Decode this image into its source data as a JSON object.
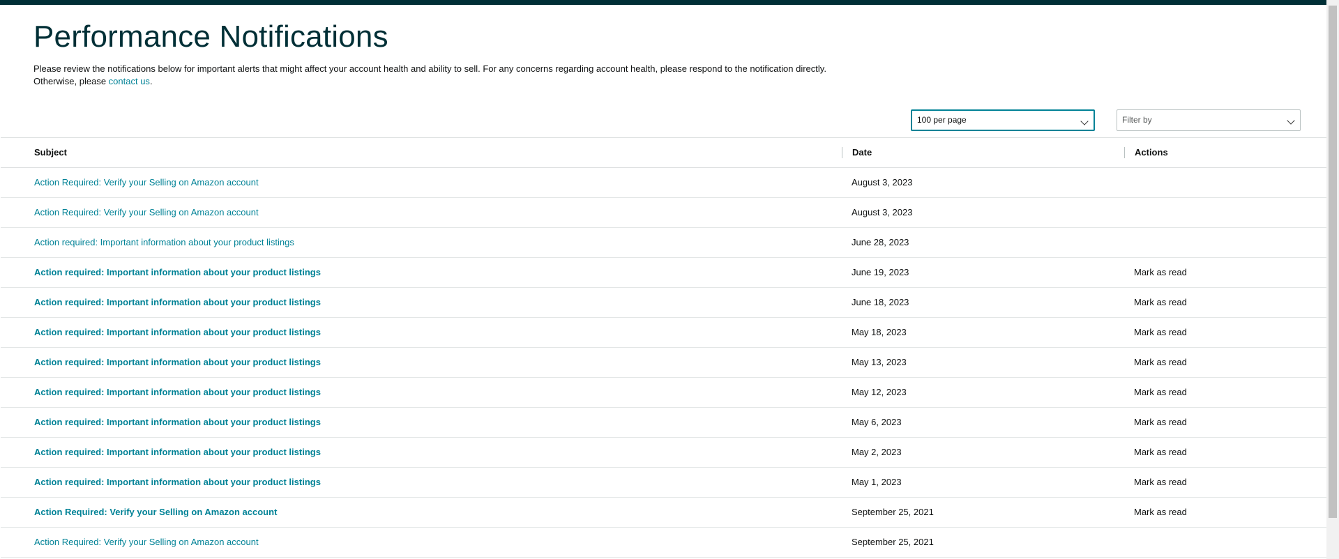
{
  "header": {
    "title": "Performance Notifications",
    "intro_line1": "Please review the notifications below for important alerts that might affect your account health and ability to sell. For any concerns regarding account health, please respond to the notification directly.",
    "intro_line2_prefix": "Otherwise, please ",
    "contact_link": "contact us",
    "intro_line2_suffix": "."
  },
  "controls": {
    "per_page": "100 per page",
    "filter_placeholder": "Filter by"
  },
  "table": {
    "columns": {
      "subject": "Subject",
      "date": "Date",
      "actions": "Actions"
    },
    "rows": [
      {
        "subject": "Action Required: Verify your Selling on Amazon account",
        "date": "August 3, 2023",
        "action": "",
        "unread": false
      },
      {
        "subject": "Action Required: Verify your Selling on Amazon account",
        "date": "August 3, 2023",
        "action": "",
        "unread": false
      },
      {
        "subject": "Action required: Important information about your product listings",
        "date": "June 28, 2023",
        "action": "",
        "unread": false
      },
      {
        "subject": "Action required: Important information about your product listings",
        "date": "June 19, 2023",
        "action": "Mark as read",
        "unread": true
      },
      {
        "subject": "Action required: Important information about your product listings",
        "date": "June 18, 2023",
        "action": "Mark as read",
        "unread": true
      },
      {
        "subject": "Action required: Important information about your product listings",
        "date": "May 18, 2023",
        "action": "Mark as read",
        "unread": true
      },
      {
        "subject": "Action required: Important information about your product listings",
        "date": "May 13, 2023",
        "action": "Mark as read",
        "unread": true
      },
      {
        "subject": "Action required: Important information about your product listings",
        "date": "May 12, 2023",
        "action": "Mark as read",
        "unread": true
      },
      {
        "subject": "Action required: Important information about your product listings",
        "date": "May 6, 2023",
        "action": "Mark as read",
        "unread": true
      },
      {
        "subject": "Action required: Important information about your product listings",
        "date": "May 2, 2023",
        "action": "Mark as read",
        "unread": true
      },
      {
        "subject": "Action required: Important information about your product listings",
        "date": "May 1, 2023",
        "action": "Mark as read",
        "unread": true
      },
      {
        "subject": "Action Required: Verify your Selling on Amazon account",
        "date": "September 25, 2021",
        "action": "Mark as read",
        "unread": true
      },
      {
        "subject": "Action Required: Verify your Selling on Amazon account",
        "date": "September 25, 2021",
        "action": "",
        "unread": false
      }
    ]
  },
  "colors": {
    "top_bar": "#002f36",
    "link": "#008296",
    "title": "#002f36",
    "focus_border": "#008296"
  },
  "icons": {
    "dropdown": "chevron-down-icon"
  }
}
